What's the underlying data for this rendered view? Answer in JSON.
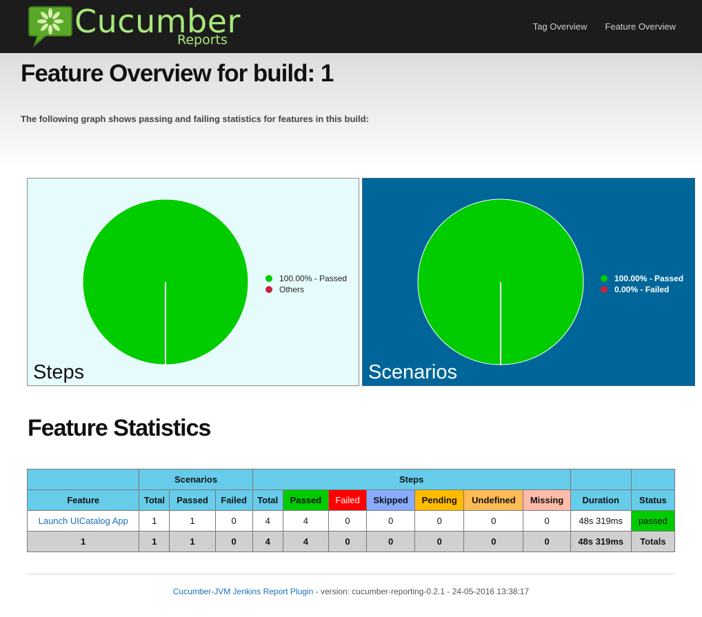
{
  "header": {
    "logo_title": "Cucumber",
    "logo_subtitle": "Reports",
    "nav": [
      "Tag Overview",
      "Feature Overview"
    ]
  },
  "page": {
    "title": "Feature Overview for build: 1",
    "subtitle": "The following graph shows passing and failing statistics for features in this build:"
  },
  "colors": {
    "passed": "#00cc00",
    "failed": "#cc1f3a",
    "steps_bg": "#e6fbfb",
    "scenarios_bg": "#006699"
  },
  "chart_data": [
    {
      "type": "pie",
      "title": "Steps",
      "slices": [
        {
          "label": "100.00% - Passed",
          "value": 100
        },
        {
          "label": "Others",
          "value": 0
        }
      ]
    },
    {
      "type": "pie",
      "title": "Scenarios",
      "slices": [
        {
          "label": "100.00% - Passed",
          "value": 100
        },
        {
          "label": "0.00% - Failed",
          "value": 0
        }
      ]
    }
  ],
  "stats": {
    "title": "Feature Statistics",
    "group_headers": {
      "scenarios": "Scenarios",
      "steps": "Steps"
    },
    "columns": [
      "Feature",
      "Total",
      "Passed",
      "Failed",
      "Total",
      "Passed",
      "Failed",
      "Skipped",
      "Pending",
      "Undefined",
      "Missing",
      "Duration",
      "Status"
    ],
    "row": {
      "feature": "Launch UICatalog App",
      "cells": [
        "1",
        "1",
        "0",
        "4",
        "4",
        "0",
        "0",
        "0",
        "0",
        "0",
        "48s 319ms"
      ],
      "status": "passed"
    },
    "totals": {
      "feature": "1",
      "cells": [
        "1",
        "1",
        "0",
        "4",
        "4",
        "0",
        "0",
        "0",
        "0",
        "0",
        "48s 319ms"
      ],
      "label": "Totals"
    }
  },
  "footer": {
    "link": "Cucumber-JVM Jenkins Report Plugin",
    "text": " - version: cucumber-reporting-0.2.1 - 24-05-2016 13:38:17"
  }
}
